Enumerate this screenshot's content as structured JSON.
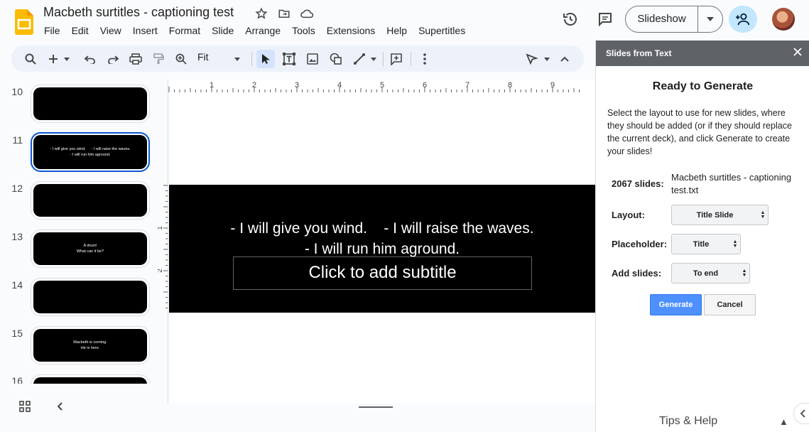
{
  "app": {
    "doc_title": "Macbeth surtitles - captioning test",
    "menu": [
      "File",
      "Edit",
      "View",
      "Insert",
      "Format",
      "Slide",
      "Arrange",
      "Tools",
      "Extensions",
      "Help",
      "Supertitles"
    ],
    "slideshow_label": "Slideshow"
  },
  "toolbar": {
    "zoom_value": "Fit"
  },
  "filmstrip": {
    "slides": [
      {
        "num": "10",
        "lines": []
      },
      {
        "num": "11",
        "lines": [
          "- I will give you wind.     - I will raise the waves.",
          "- I will run him aground."
        ],
        "selected": true
      },
      {
        "num": "12",
        "lines": []
      },
      {
        "num": "13",
        "lines": [
          "A drum!",
          "What can it be?"
        ]
      },
      {
        "num": "14",
        "lines": []
      },
      {
        "num": "15",
        "lines": [
          "Macbeth is coming.",
          "He is here."
        ]
      },
      {
        "num": "16",
        "lines": []
      }
    ]
  },
  "ruler": {
    "top_labels": [
      "1",
      "2",
      "3",
      "4",
      "5",
      "6",
      "7",
      "8",
      "9"
    ],
    "left_labels": [
      "1",
      "2"
    ]
  },
  "slide": {
    "title_line1": "- I will give you wind.    - I will raise the waves.",
    "title_line2": "- I will run him aground.",
    "subtitle_placeholder": "Click to add subtitle"
  },
  "panel": {
    "title": "Slides from Text",
    "heading": "Ready to Generate",
    "description": "Select the layout to use for new slides, where they should be added (or if they should replace the current deck), and click Generate to create your slides!",
    "count_label": "2067 slides:",
    "file_name": "Macbeth surtitles - captioning test.txt",
    "layout_label": "Layout:",
    "layout_value": "Title Slide",
    "placeholder_label": "Placeholder:",
    "placeholder_value": "Title",
    "add_label": "Add slides:",
    "add_value": "To end",
    "generate_label": "Generate",
    "cancel_label": "Cancel",
    "tips_label": "Tips & Help",
    "tips_arrow": "▲"
  }
}
